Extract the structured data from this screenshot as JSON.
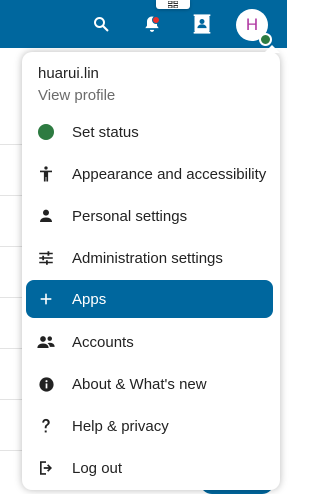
{
  "header": {
    "accent_color": "#00679e",
    "icons": [
      "magnifier-icon",
      "bell-icon",
      "contacts-icon"
    ],
    "has_unread_notifications": true
  },
  "avatar": {
    "initial": "H",
    "initial_color": "#b037a2",
    "status_color": "#2d7b41"
  },
  "menu": {
    "profile": {
      "name": "huarui.lin",
      "link": "View profile"
    },
    "items": [
      {
        "label": "Set status",
        "icon": "status-dot-icon",
        "status_color": "#2d7b41"
      },
      {
        "label": "Appearance and accessibility",
        "icon": "accessibility-icon"
      },
      {
        "label": "Personal settings",
        "icon": "person-icon"
      },
      {
        "label": "Administration settings",
        "icon": "sliders-icon"
      },
      {
        "label": "Apps",
        "icon": "plus-icon",
        "active": true
      },
      {
        "label": "Accounts",
        "icon": "people-icon"
      },
      {
        "label": "About & What's new",
        "icon": "info-icon"
      },
      {
        "label": "Help & privacy",
        "icon": "question-mark-icon"
      },
      {
        "label": "Log out",
        "icon": "logout-icon"
      }
    ]
  }
}
